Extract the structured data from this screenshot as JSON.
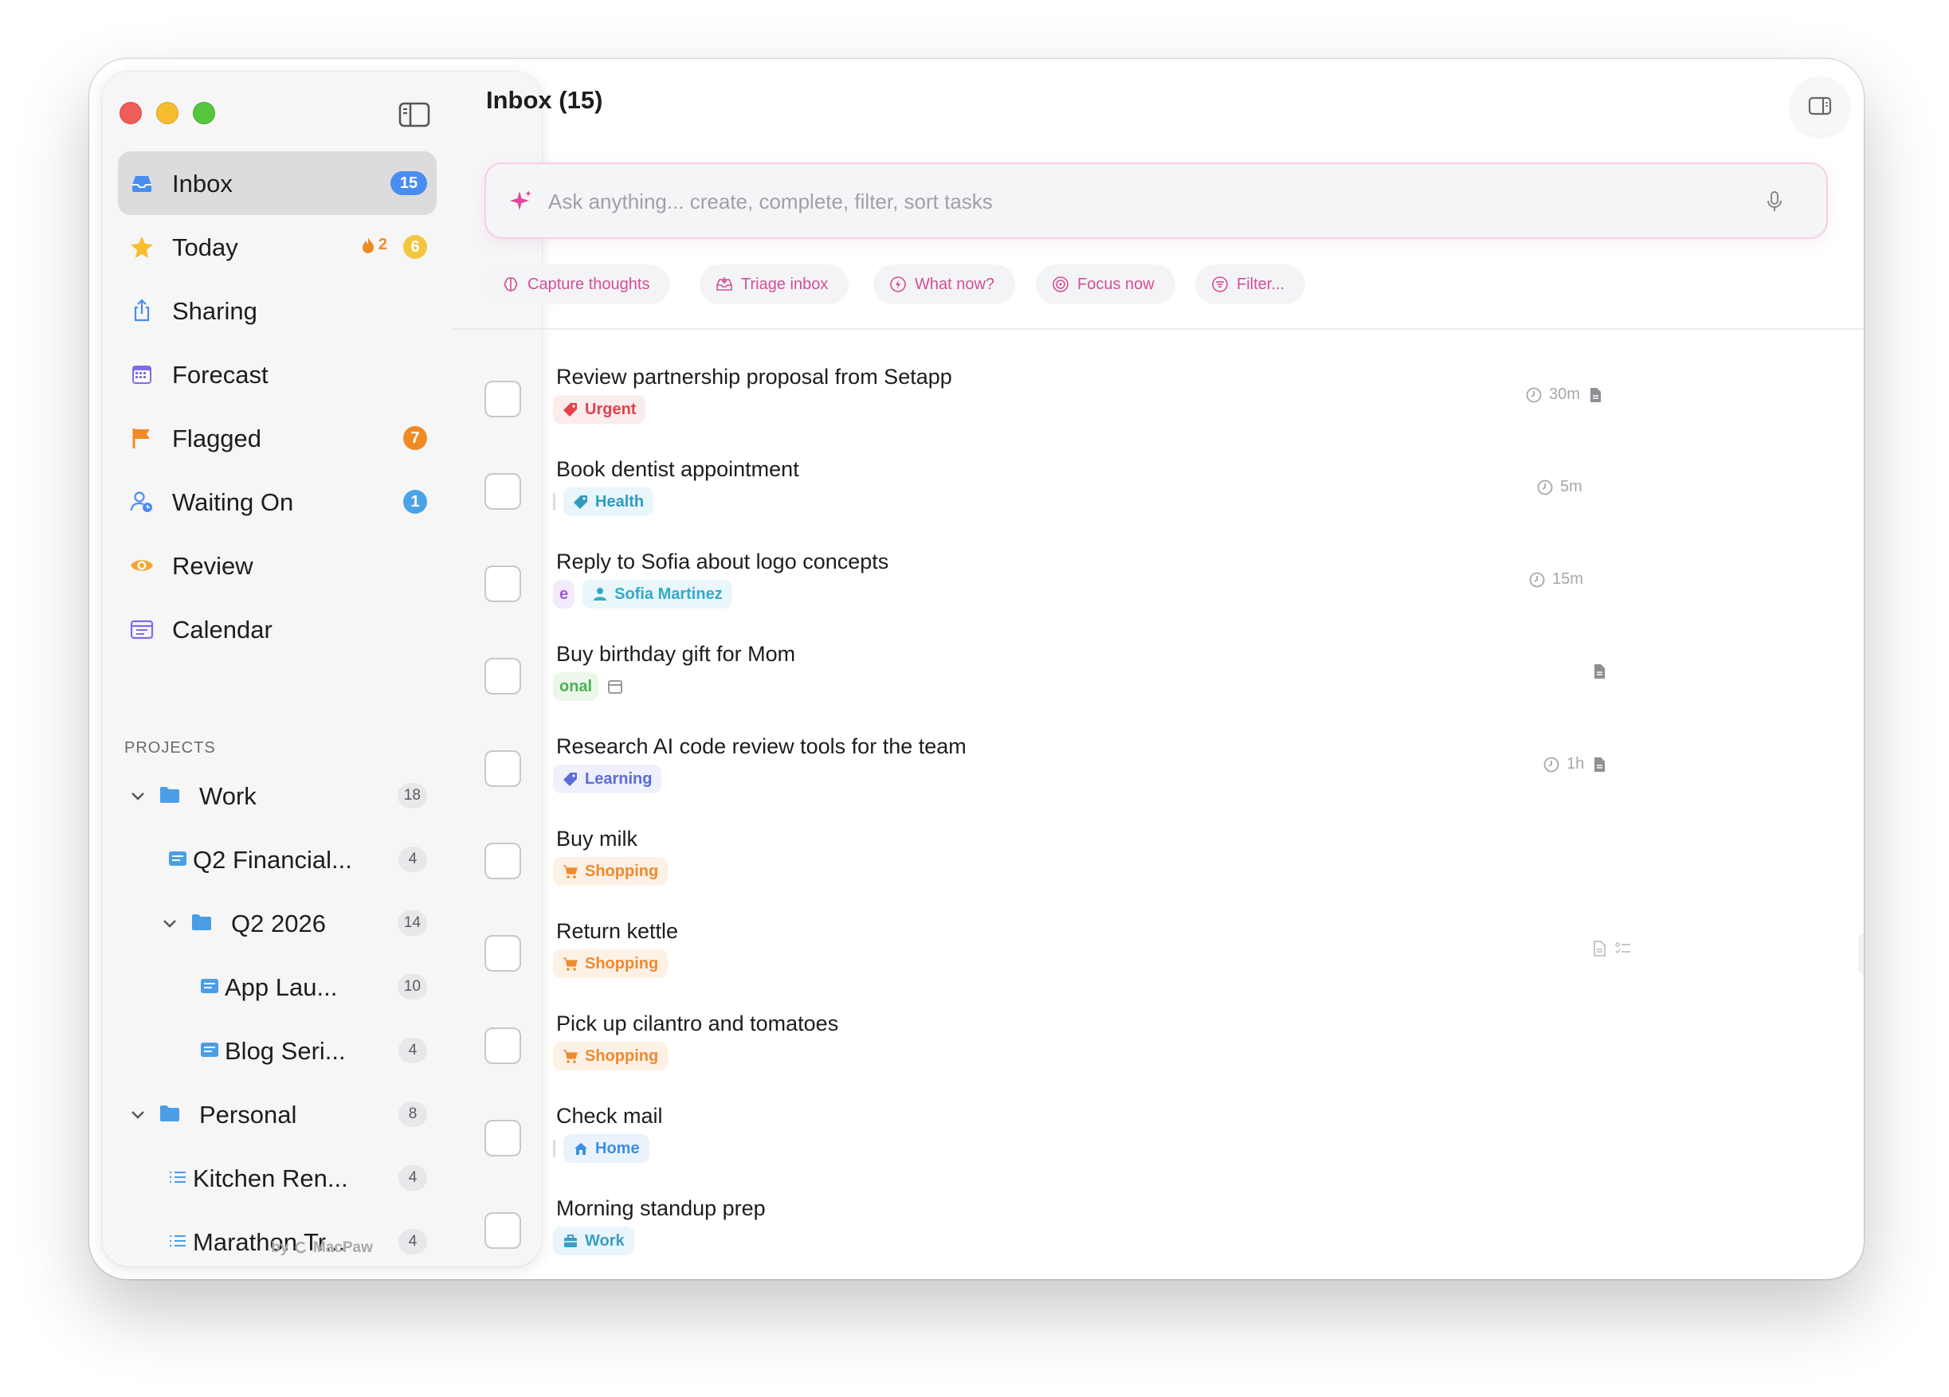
{
  "window": {
    "title": "Inbox (15)"
  },
  "sidebar": {
    "nav": [
      {
        "label": "Inbox",
        "badge": "15",
        "badge_color": "#4a8df0",
        "icon": "inbox-icon",
        "active": true
      },
      {
        "label": "Today",
        "badge": "6",
        "badge_color": "#f3c640",
        "icon": "star-icon",
        "streak": "2"
      },
      {
        "label": "Sharing",
        "badge": "",
        "icon": "share-icon"
      },
      {
        "label": "Forecast",
        "badge": "",
        "icon": "calendar-grid-icon"
      },
      {
        "label": "Flagged",
        "badge": "7",
        "badge_color": "#f08a24",
        "icon": "flag-icon"
      },
      {
        "label": "Waiting On",
        "badge": "1",
        "badge_color": "#4aa3e6",
        "icon": "person-clock-icon"
      },
      {
        "label": "Review",
        "badge": "",
        "icon": "eye-icon"
      },
      {
        "label": "Calendar",
        "badge": "",
        "icon": "calendar-list-icon"
      }
    ],
    "projects_title": "PROJECTS",
    "projects": [
      {
        "label": "Work",
        "count": "18",
        "type": "folder",
        "depth": 0,
        "expanded": true
      },
      {
        "label": "Q2 Financial...",
        "count": "4",
        "type": "project",
        "depth": 1
      },
      {
        "label": "Q2 2026",
        "count": "14",
        "type": "folder",
        "depth": 1,
        "expanded": true
      },
      {
        "label": "App Lau...",
        "count": "10",
        "type": "project",
        "depth": 2
      },
      {
        "label": "Blog Seri...",
        "count": "4",
        "type": "project",
        "depth": 2
      },
      {
        "label": "Personal",
        "count": "8",
        "type": "folder",
        "depth": 0,
        "expanded": true
      },
      {
        "label": "Kitchen Ren...",
        "count": "4",
        "type": "list",
        "depth": 1
      },
      {
        "label": "Marathon Tr...",
        "count": "4",
        "type": "list",
        "depth": 1
      }
    ],
    "brand_prefix": "by",
    "brand_name": "MacPaw"
  },
  "main": {
    "title": "Inbox (15)",
    "ai_placeholder": "Ask anything... create, complete, filter, sort tasks",
    "chips": [
      {
        "label": "Capture thoughts",
        "icon": "brain-icon"
      },
      {
        "label": "Triage inbox",
        "icon": "tray-icon"
      },
      {
        "label": "What now?",
        "icon": "bolt-icon"
      },
      {
        "label": "Focus now",
        "icon": "target-icon"
      },
      {
        "label": "Filter...",
        "icon": "filter-icon"
      }
    ],
    "tasks": [
      {
        "title": "Review partnership proposal from Setapp",
        "tags": [
          {
            "label": "Urgent",
            "color": "#e0434b",
            "bg": "#fdecec",
            "icon": "tag-icon"
          }
        ],
        "duration": "30m",
        "note": true,
        "flag": true
      },
      {
        "title": "Book dentist appointment",
        "partial": "",
        "tags": [
          {
            "label": "Health",
            "color": "#2f9bc1",
            "bg": "#e8f5fa",
            "icon": "tag-icon"
          }
        ],
        "duration": "5m"
      },
      {
        "title": "Reply to Sofia about logo concepts",
        "partial": "e",
        "partial_color": "#9b5cd6",
        "partial_bg": "#f3ebfb",
        "tags": [
          {
            "label": "Sofia Martinez",
            "color": "#34a9c7",
            "bg": "#e9f6fa",
            "icon": "person-icon"
          }
        ],
        "duration": "15m"
      },
      {
        "title": "Buy birthday gift for Mom",
        "partial": "onal",
        "partial_color": "#4caf50",
        "partial_bg": "#ecf7ec",
        "tags": [],
        "calendar": true,
        "note": true
      },
      {
        "title": "Research AI code review tools for the team",
        "tags": [
          {
            "label": "Learning",
            "color": "#5b6bd8",
            "bg": "#eef0fc",
            "icon": "tag-icon"
          }
        ],
        "duration": "1h",
        "note": true
      },
      {
        "title": "Buy milk",
        "tags": [
          {
            "label": "Shopping",
            "color": "#ef8a2e",
            "bg": "#fdf1e6",
            "icon": "cart-icon"
          }
        ]
      },
      {
        "title": "Return kettle",
        "tags": [
          {
            "label": "Shopping",
            "color": "#ef8a2e",
            "bg": "#fdf1e6",
            "icon": "cart-icon"
          }
        ],
        "hover_actions": true
      },
      {
        "title": "Pick up cilantro and tomatoes",
        "tags": [
          {
            "label": "Shopping",
            "color": "#ef8a2e",
            "bg": "#fdf1e6",
            "icon": "cart-icon"
          }
        ]
      },
      {
        "title": "Check mail",
        "partial": "",
        "tags": [
          {
            "label": "Home",
            "color": "#3c8fe0",
            "bg": "#eaf3fc",
            "icon": "house-icon"
          }
        ]
      },
      {
        "title": "Morning standup prep",
        "tags": [
          {
            "label": "Work",
            "color": "#3a9ec4",
            "bg": "#e8f5fa",
            "icon": "briefcase-icon"
          }
        ]
      }
    ]
  }
}
